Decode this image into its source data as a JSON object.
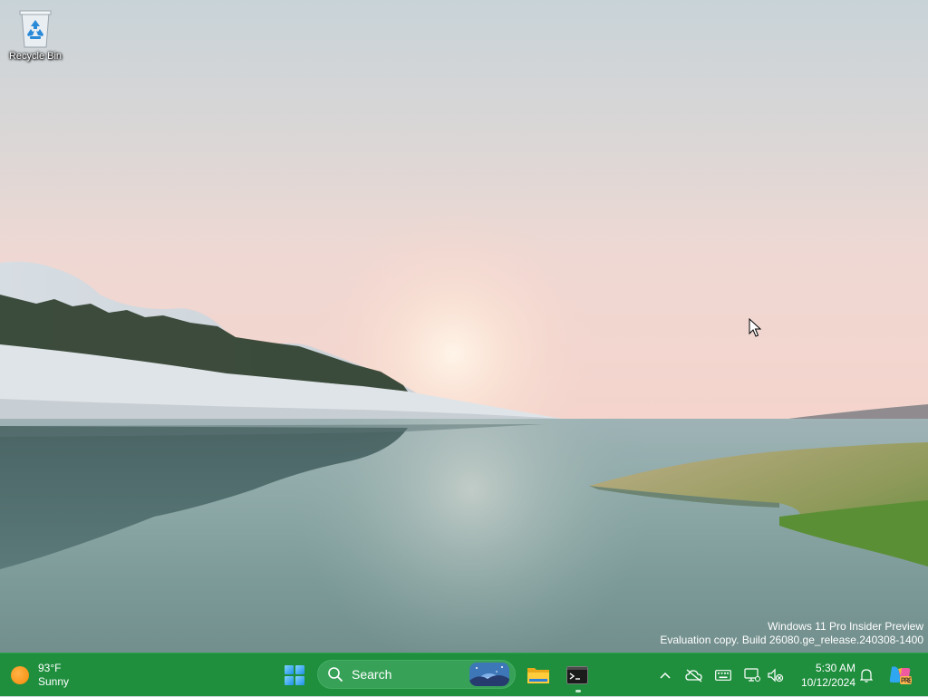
{
  "desktop": {
    "icons": [
      {
        "label": "Recycle Bin",
        "icon": "recycle-bin-icon"
      }
    ],
    "watermark": {
      "line1": "Windows 11 Pro Insider Preview",
      "line2": "Evaluation copy. Build 26080.ge_release.240308-1400"
    }
  },
  "taskbar": {
    "accent_color": "#1f8f3e",
    "weather": {
      "temperature": "93°F",
      "condition": "Sunny",
      "icon": "sun-icon"
    },
    "start": {
      "icon": "windows-logo-icon"
    },
    "search": {
      "placeholder": "Search",
      "icon": "search-icon"
    },
    "pinned_apps": [
      {
        "name": "File Explorer",
        "icon": "folder-icon",
        "running": false
      },
      {
        "name": "Terminal",
        "icon": "terminal-icon",
        "running": true
      }
    ],
    "tray": {
      "icons": [
        "chevron-up-icon",
        "onedrive-off-icon",
        "keyboard-icon",
        "network-icon",
        "volume-muted-icon"
      ],
      "time": "5:30 AM",
      "date": "10/12/2024",
      "notification_icon": "bell-icon",
      "copilot_icon": "copilot-icon"
    }
  }
}
